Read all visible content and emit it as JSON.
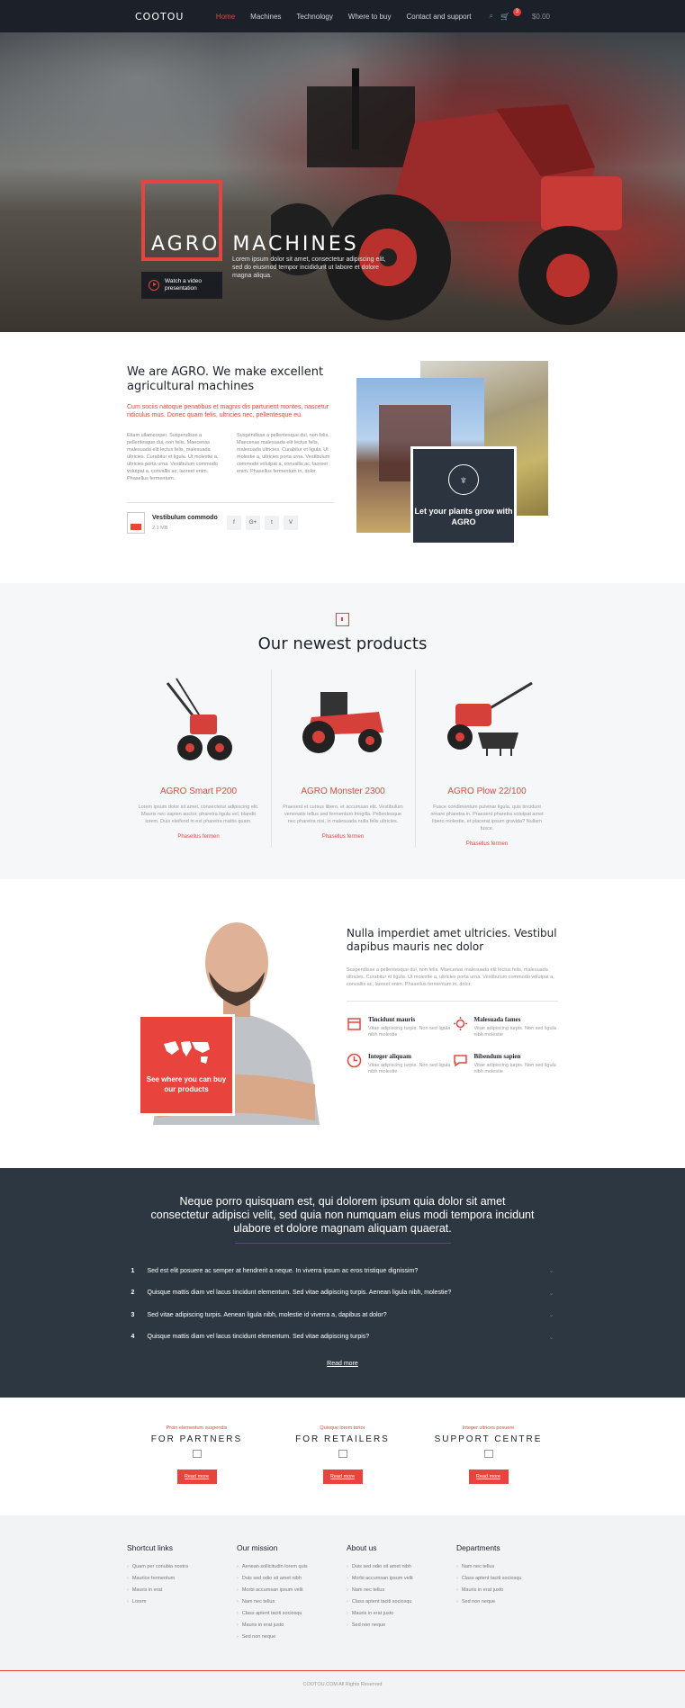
{
  "header": {
    "logo": "COOTOU",
    "nav": [
      "Home",
      "Machines",
      "Technology",
      "Where to buy",
      "Contact and support"
    ],
    "active_nav": "Home",
    "cart_count": "3",
    "cart_total": "$0.00"
  },
  "hero": {
    "title_1": "AGRO",
    "title_2": "MACHINES",
    "description": "Lorem ipsum dolor sit amet, consectetur adipiscing elit, sed do eiusmod tempor incididunt ut labore et dolore magna aliqua.",
    "video_label": "Watch a video presentation"
  },
  "about": {
    "title": "We are AGRO. We make excellent agricultural machines",
    "lead": "Cum sociis natoque penatibus et magnis dis parturient montes, nascetur ridiculus mus. Donec quam felis, ultricies nec, pellentesque eu.",
    "col1": "Etiam ullamcorper. Suspendisse a pellentesque dui, non felis. Maecenas malesuada elit lectus felis, malesuada ultricies. Curabitur et ligula. Ut molestie a, ultricies porta urna. Vestibulum commodo volutpat a, convallis ac, laoreet enim. Phasellus fermentum.",
    "col2": "Suspendisse a pellentesque dui, non felis. Maecenas malesuada elit lectus felis, malesuada ultricies. Curabitur et ligula. Ut molestie a, ultricies porta urna. Vestibulum commodo volutpat a, convallis ac, laoreet enim. Phasellus fermentum in, dolor.",
    "file_name": "Vestibulum commodo",
    "file_size": "2.1 MB",
    "socials": [
      "f",
      "G+",
      "t",
      "V"
    ],
    "card_text": "Let your plants grow with AGRO"
  },
  "products": {
    "title": "Our newest products",
    "items": [
      {
        "name": "AGRO Smart P200",
        "desc": "Lorem ipsum dolor sit amet, consectetur adipiscing elit. Mauris nec sapien auctor, pharetra ligula vel, blandit lorem. Duis eleifend in est pharetra mattis quam.",
        "link": "Phasellus fermen"
      },
      {
        "name": "AGRO Monster 2300",
        "desc": "Praesent et cursus libero, et accumsan elit. Vestibulum venenatis tellus sed fermentum fringilla. Pellentesque nec pharetra nisi, in malesuada nulla felis ultricies.",
        "link": "Phasellus fermen"
      },
      {
        "name": "AGRO Plow 22/100",
        "desc": "Fusce condimentum pulvinar ligula, quis tincidunt ornare pharetra in. Praesent pharetra volutpat amet libero molestie, et placerat ipsum gravida? Nullam fusce.",
        "link": "Phasellus fermen"
      }
    ]
  },
  "team": {
    "title": "Nulla imperdiet amet ultricies. Vestibul dapibus mauris nec dolor",
    "desc": "Suspendisse a pellentesque dui, non felis. Maecenas malesuada elit lectus felis, malesuada ultricies. Curabitur et ligula. Ut molestie a, ultricies porta urna. Vestibulum commodo volutpat a, convallis ac, laoreet enim. Phasellus fermentum in, dolor.",
    "card_text": "See where you can buy our products",
    "features": [
      {
        "title": "Tincidunt mauris",
        "desc": "Vitae adipiscing turpis. Non sed ligula nibh molestie"
      },
      {
        "title": "Malesuada fames",
        "desc": "Vitae adipiscing turpis. Non sed ligula nibh molestie"
      },
      {
        "title": "Integer aliquam",
        "desc": "Vitae adipiscing turpis. Non sed ligula nibh molestie"
      },
      {
        "title": "Bibendum sapien",
        "desc": "Vitae adipiscing turpis. Non sed ligula nibh molestie"
      }
    ]
  },
  "faq": {
    "title": "Neque porro quisquam est, qui dolorem ipsum quia dolor sit amet consectetur adipisci velit, sed quia non numquam eius modi tempora incidunt ulabore et dolore magnam aliquam quaerat.",
    "items": [
      {
        "num": "1",
        "q": "Sed est elit posuere ac semper at hendrerit a neque. In viverra ipsum ac eros tristique dignissim?"
      },
      {
        "num": "2",
        "q": "Quisque mattis diam vel lacus tincidunt elementum. Sed vitae adipiscing turpis. Aenean ligula nibh, molestie?"
      },
      {
        "num": "3",
        "q": "Sed vitae adipiscing turpis. Aenean ligula nibh, molestie id viverra a, dapibus at dolor?"
      },
      {
        "num": "4",
        "q": "Quisque mattis diam vel lacus tincidunt elementum. Sed vitae adipiscing turpis?"
      }
    ],
    "more": "Read more"
  },
  "partners": [
    {
      "sub": "Proin elementum suspendis",
      "title": "FOR PARTNERS",
      "btn": "Read more"
    },
    {
      "sub": "Quisque lorem tortor",
      "title": "FOR RETAILERS",
      "btn": "Read more"
    },
    {
      "sub": "Integer ultrices posuere",
      "title": "SUPPORT CENTRE",
      "btn": "Read more"
    }
  ],
  "footer": {
    "cols": [
      {
        "title": "Shortcut links",
        "items": [
          "Quam per conubia nostra",
          "Maurice fermentum",
          "Mauris in erat",
          "Lorem"
        ]
      },
      {
        "title": "Our mission",
        "items": [
          "Aenean sollicitudin lorem quis",
          "Duis sed odio sit amet nibh",
          "Morbi accumsan ipsum velit",
          "Nam nec tellus",
          "Class aptent taciti sociosqu",
          "Mauris in erat justo",
          "Sed non neque"
        ]
      },
      {
        "title": "About us",
        "items": [
          "Duis sed odio sit amet nibh",
          "Morbi accumsan ipsum velit",
          "Nam nec tellus",
          "Class aptent taciti sociosqu",
          "Mauris in erat justo",
          "Sed non neque"
        ]
      },
      {
        "title": "Departments",
        "items": [
          "Nam nec tellus",
          "Class aptent taciti sociosqu",
          "Mauris in erat justo",
          "Sed non neque"
        ]
      }
    ],
    "copyright": "COOTOU.COM All Rights Reserved"
  },
  "colors": {
    "accent": "#e8443d",
    "dark": "#1c2129",
    "slate": "#2d3742"
  }
}
